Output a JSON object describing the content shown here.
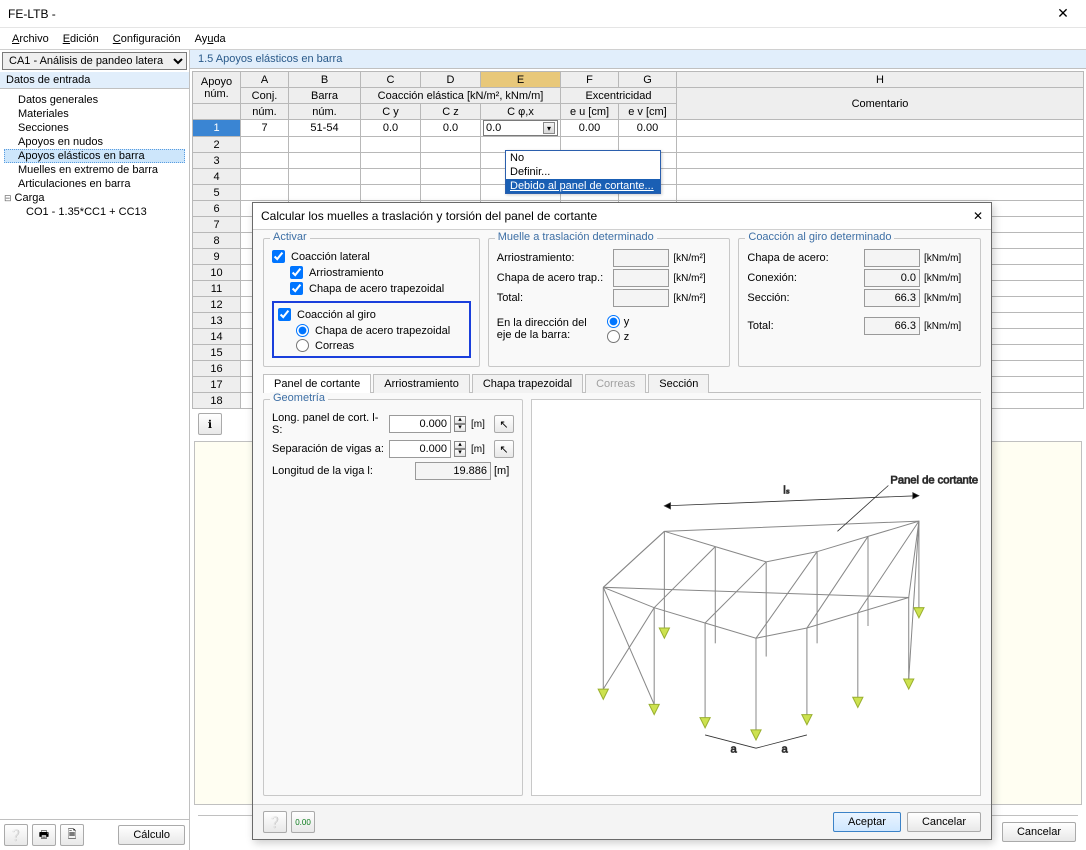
{
  "window": {
    "title": "FE-LTB -"
  },
  "menu": {
    "file": "Archivo",
    "edit": "Edición",
    "config": "Configuración",
    "help": "Ayuda"
  },
  "sidebar": {
    "combo": "CA1 - Análisis de pandeo latera",
    "header": "Datos de entrada",
    "items": [
      "Datos generales",
      "Materiales",
      "Secciones",
      "Apoyos en nudos",
      "Apoyos elásticos en barra",
      "Muelles en extremo de barra",
      "Articulaciones en barra"
    ],
    "carga": "Carga",
    "carga_item": "CO1 - 1.35*CC1 + CC13",
    "btn_calc": "Cálculo"
  },
  "main": {
    "title": "1.5 Apoyos elásticos en barra",
    "cols_letters": [
      "A",
      "B",
      "C",
      "D",
      "E",
      "F",
      "G",
      "H"
    ],
    "head_apoyo": "Apoyo\nnúm.",
    "head_conj": "Conj.\nnúm.",
    "head_barra": "Barra\nnúm.",
    "head_coaccion": "Coacción elástica  [kN/m², kNm/m]",
    "head_cy": "C y",
    "head_cz": "C z",
    "head_cphi": "C φ,x",
    "head_excentric": "Excentricidad",
    "head_eu": "e u [cm]",
    "head_ev": "e v [cm]",
    "head_comentario": "Comentario",
    "row1": {
      "num": "1",
      "conj": "7",
      "barra": "51-54",
      "cy": "0.0",
      "cz": "0.0",
      "cphi": "0.0",
      "eu": "0.00",
      "ev": "0.00"
    },
    "dd": {
      "no": "No",
      "definir": "Definir...",
      "debido": "Debido al panel de cortante..."
    },
    "cancel": "Cancelar"
  },
  "dialog": {
    "title": "Calcular los muelles a traslación y torsión del panel de cortante",
    "grp_activar": "Activar",
    "chk_lateral": "Coacción lateral",
    "chk_arrio": "Arriostramiento",
    "chk_trap": "Chapa de acero trapezoidal",
    "chk_giro": "Coacción al giro",
    "rad_trap": "Chapa de acero trapezoidal",
    "rad_correas": "Correas",
    "grp_muelle": "Muelle a traslación determinado",
    "m_arrio": "Arriostramiento:",
    "m_trap": "Chapa de acero trap.:",
    "m_total": "Total:",
    "u_kNm2": "[kN/m²]",
    "u_kNmm": "[kNm/m]",
    "dir_lbl": "En la dirección del eje de la barra:",
    "dir_y": "y",
    "dir_z": "z",
    "grp_coacc": "Coacción al giro determinado",
    "c_chapa": "Chapa de acero:",
    "c_conex": "Conexión:",
    "c_secc": "Sección:",
    "c_total": "Total:",
    "c_val_chapa": "",
    "c_val_conex": "0.0",
    "c_val_secc": "66.3",
    "c_val_total": "66.3",
    "tabs": {
      "panel": "Panel de cortante",
      "arrio": "Arriostramiento",
      "chapa": "Chapa trapezoidal",
      "correas": "Correas",
      "seccion": "Sección"
    },
    "grp_geom": "Geometría",
    "g_long_s": "Long. panel de cort. l-S:",
    "g_sep": "Separación de vigas a:",
    "g_long_i": "Longitud de la viga l:",
    "g_val_s": "0.000",
    "g_val_sep": "0.000",
    "g_val_i": "19.886",
    "u_m": "[m]",
    "preview_label": "Panel de cortante",
    "ls": "lₛ",
    "a": "a",
    "ok": "Aceptar",
    "cancel": "Cancelar"
  }
}
